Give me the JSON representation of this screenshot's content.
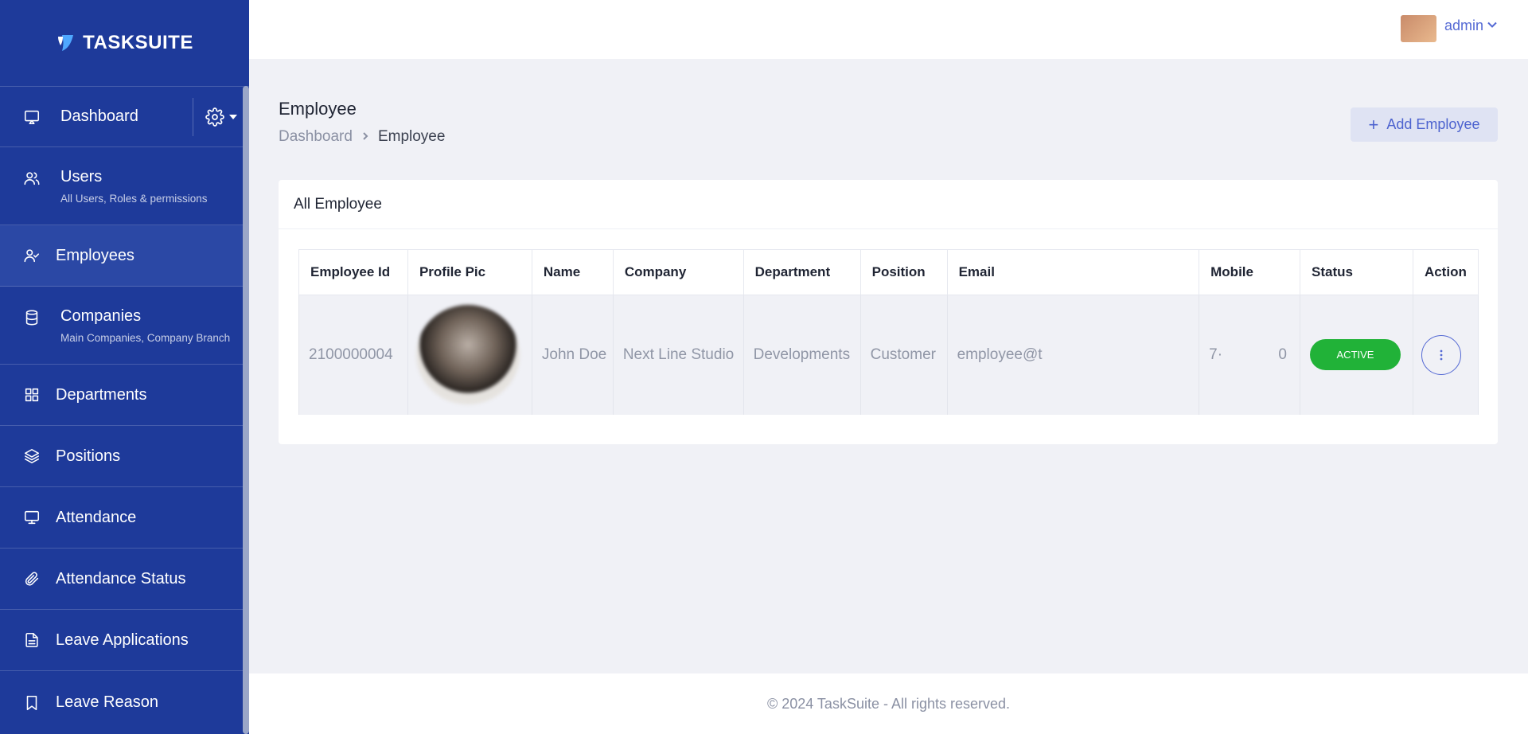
{
  "brand": {
    "name": "TASKSUITE"
  },
  "sidebar": {
    "items": [
      {
        "label": "Dashboard",
        "icon": "monitor-play-icon"
      },
      {
        "label": "Users",
        "sub": "All Users, Roles & permissions",
        "icon": "users-icon"
      },
      {
        "label": "Employees",
        "icon": "user-check-icon",
        "active": true
      },
      {
        "label": "Companies",
        "sub": "Main Companies, Company Branch",
        "icon": "database-icon"
      },
      {
        "label": "Departments",
        "icon": "grid-icon"
      },
      {
        "label": "Positions",
        "icon": "layers-icon"
      },
      {
        "label": "Attendance",
        "icon": "monitor-icon"
      },
      {
        "label": "Attendance Status",
        "icon": "paperclip-icon"
      },
      {
        "label": "Leave Applications",
        "icon": "file-text-icon"
      },
      {
        "label": "Leave Reason",
        "icon": "bookmark-icon"
      }
    ]
  },
  "header": {
    "user_name": "admin"
  },
  "page": {
    "title": "Employee",
    "breadcrumb": {
      "parent": "Dashboard",
      "current": "Employee"
    },
    "add_button": "Add Employee"
  },
  "card": {
    "title": "All Employee"
  },
  "table": {
    "columns": [
      "Employee Id",
      "Profile Pic",
      "Name",
      "Company",
      "Department",
      "Position",
      "Email",
      "Mobile",
      "Status",
      "Action"
    ],
    "rows": [
      {
        "employee_id": "2100000004",
        "name": "John Doe",
        "company": "Next Line Studio",
        "department": "Developments",
        "position": "Customer",
        "email": "employee@t",
        "mobile_start": "7·",
        "mobile_end": "0",
        "status": "ACTIVE"
      }
    ]
  },
  "footer": {
    "text": "© 2024 TaskSuite - All rights reserved."
  },
  "colors": {
    "sidebar": "#1e3a9a",
    "accent": "#5469d4",
    "status_active": "#21b238"
  }
}
